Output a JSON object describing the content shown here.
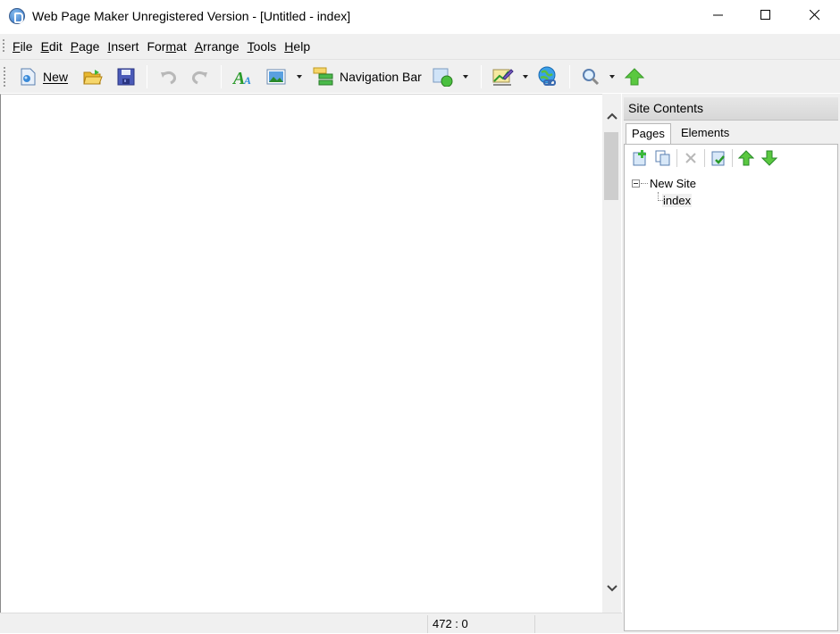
{
  "window": {
    "title": "Web Page Maker Unregistered Version - [Untitled - index]",
    "controls": [
      "minimize",
      "maximize",
      "close"
    ]
  },
  "menu": {
    "items": [
      {
        "label": "File",
        "mnemonic": "F"
      },
      {
        "label": "Edit",
        "mnemonic": "E"
      },
      {
        "label": "Page",
        "mnemonic": "P"
      },
      {
        "label": "Insert",
        "mnemonic": "I"
      },
      {
        "label": "Format",
        "mnemonic": "m"
      },
      {
        "label": "Arrange",
        "mnemonic": "A"
      },
      {
        "label": "Tools",
        "mnemonic": "T"
      },
      {
        "label": "Help",
        "mnemonic": "H"
      }
    ]
  },
  "toolbar": {
    "new_label": "New",
    "navbar_label": "Navigation Bar",
    "icons": [
      "new-page-icon",
      "open-folder-icon",
      "save-icon",
      "undo-icon",
      "redo-icon",
      "text-icon",
      "image-icon",
      "navigation-bar-icon",
      "shape-icon",
      "color-picker-icon",
      "web-link-icon",
      "zoom-icon",
      "publish-icon"
    ]
  },
  "statusbar": {
    "coords": "472 : 0"
  },
  "side_panel": {
    "title": "Site Contents",
    "tabs": [
      {
        "label": "Pages",
        "active": true
      },
      {
        "label": "Elements",
        "active": false
      }
    ],
    "tools": [
      "add-page-icon",
      "duplicate-page-icon",
      "delete-icon",
      "page-properties-icon",
      "move-up-icon",
      "move-down-icon"
    ],
    "tree": {
      "root": "New Site",
      "children": [
        "index"
      ]
    }
  },
  "colors": {
    "chrome": "#f0f0f0",
    "green_arrow": "#3cb83c",
    "accent_blue": "#2a6cc0"
  }
}
